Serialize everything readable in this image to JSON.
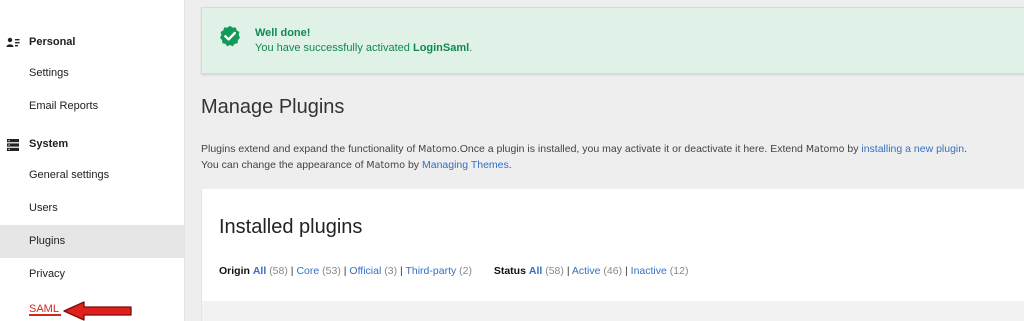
{
  "sidebar": {
    "sections": [
      {
        "icon": "personal-icon",
        "label": "Personal",
        "items": [
          "Settings",
          "Email Reports"
        ]
      },
      {
        "icon": "system-icon",
        "label": "System",
        "items": [
          "General settings",
          "Users",
          "Plugins",
          "Privacy",
          "SAML"
        ]
      }
    ],
    "active_item": "Plugins",
    "highlighted_item": "SAML"
  },
  "notification": {
    "icon": "check-badge-icon",
    "title": "Well done!",
    "message_prefix": "You have successfully activated ",
    "plugin_name": "LoginSaml",
    "message_suffix": ".",
    "color": "#0d8a4f",
    "background": "#e0f1e8"
  },
  "page": {
    "title": "Manage Plugins",
    "description": {
      "line1_prefix": "Plugins extend and expand the functionality of ",
      "brand": "Matomo",
      "line1_mid": ".Once a plugin is installed, you may activate it or deactivate it here. Extend ",
      "line1_mid2": " by ",
      "install_link": "installing a new plugin",
      "line1_suffix": ".",
      "line2_prefix": "You can change the appearance of ",
      "line2_mid": " by ",
      "themes_link": "Managing Themes",
      "line2_suffix": "."
    }
  },
  "installed": {
    "title": "Installed plugins",
    "origin_filter": {
      "label": "Origin",
      "options": [
        {
          "label": "All",
          "count": "(58)",
          "selected": true
        },
        {
          "label": "Core",
          "count": "(53)",
          "selected": false
        },
        {
          "label": "Official",
          "count": "(3)",
          "selected": false
        },
        {
          "label": "Third-party",
          "count": "(2)",
          "selected": false
        }
      ]
    },
    "status_filter": {
      "label": "Status",
      "options": [
        {
          "label": "All",
          "count": "(58)",
          "selected": true
        },
        {
          "label": "Active",
          "count": "(46)",
          "selected": false
        },
        {
          "label": "Inactive",
          "count": "(12)",
          "selected": false
        }
      ]
    }
  },
  "colors": {
    "link": "#3470c4",
    "annotation_arrow": "#e0201a",
    "saml_label": "#d4291f"
  }
}
